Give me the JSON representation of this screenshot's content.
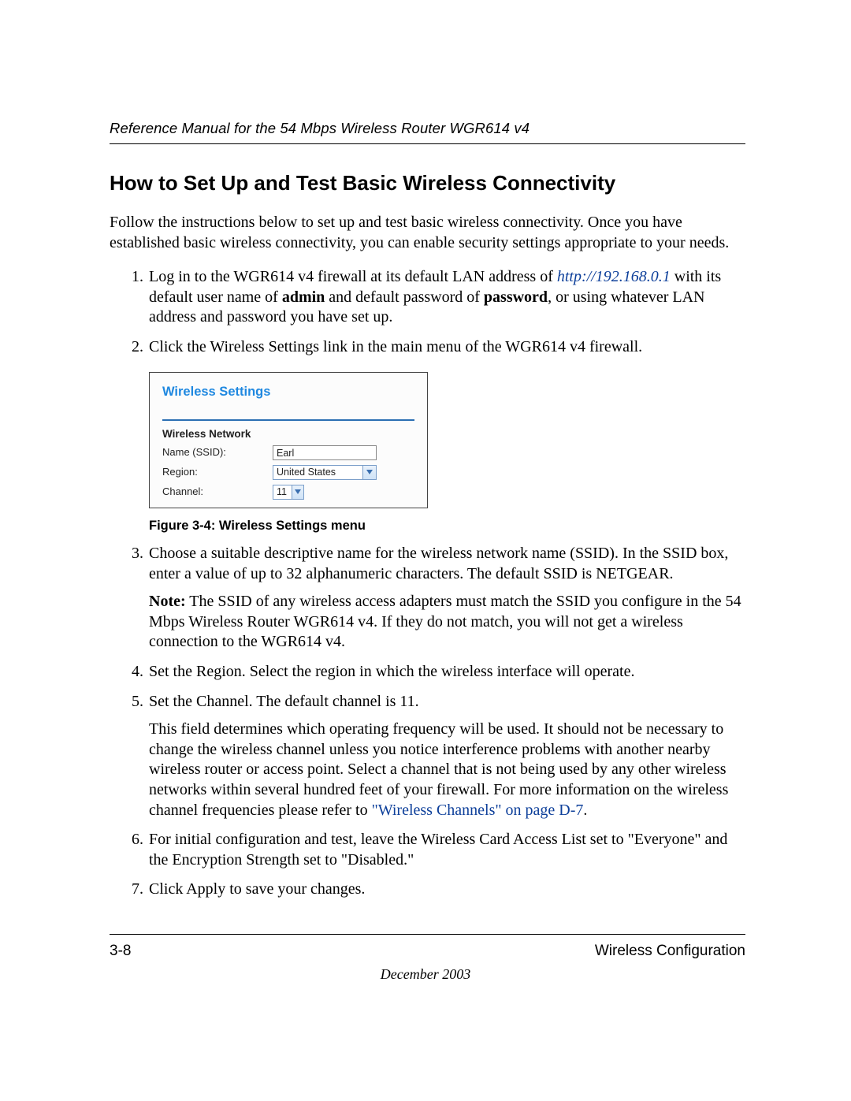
{
  "header": {
    "running_title": "Reference Manual for the 54 Mbps Wireless Router WGR614 v4"
  },
  "title": "How to Set Up and Test Basic Wireless Connectivity",
  "intro": "Follow the instructions below to set up and test basic wireless connectivity. Once you have established basic wireless connectivity, you can enable security settings appropriate to your needs.",
  "steps": {
    "s1_a": "Log in to the WGR614 v4 firewall at its default LAN address of ",
    "s1_link": "http://192.168.0.1",
    "s1_b": " with its default user name of ",
    "s1_admin": "admin",
    "s1_c": " and default password of ",
    "s1_password": "password",
    "s1_d": ", or using whatever LAN address and password you have set up.",
    "s2": "Click the Wireless Settings link in the main menu of the WGR614 v4 firewall.",
    "s3_a": "Choose a suitable descriptive name for the wireless network name (SSID). In the SSID box, enter a value of up to 32 alphanumeric characters. The default SSID is NETGEAR.",
    "s3_note_label": "Note:",
    "s3_note": " The SSID of any wireless access adapters must match the SSID you configure in the 54 Mbps Wireless Router WGR614 v4. If they do not match, you will not get a wireless connection to the WGR614 v4.",
    "s4": "Set the Region. Select the region in which the wireless interface will operate.",
    "s5": "Set the Channel. The default channel is 11.",
    "s5_para_a": "This field determines which operating frequency will be used. It should not be necessary to change the wireless channel unless you notice interference problems with another nearby wireless router or access point. Select a channel that is not being used by any other wireless networks within several hundred feet of your firewall. For more information on the wireless channel frequencies please refer to ",
    "s5_xref": "\"Wireless Channels\" on page D-7",
    "s5_para_b": ".",
    "s6": "For initial configuration and test, leave the Wireless Card Access List set to \"Everyone\" and the Encryption Strength set to \"Disabled.\"",
    "s7": "Click Apply to save your changes."
  },
  "figure": {
    "heading": "Wireless Settings",
    "section_label": "Wireless Network",
    "rows": {
      "ssid_label": "Name (SSID):",
      "ssid_value": "Earl",
      "region_label": "Region:",
      "region_value": "United States",
      "channel_label": "Channel:",
      "channel_value": "11"
    },
    "caption": "Figure 3-4:  Wireless Settings menu"
  },
  "footer": {
    "page_number": "3-8",
    "section": "Wireless Configuration",
    "date": "December 2003"
  }
}
